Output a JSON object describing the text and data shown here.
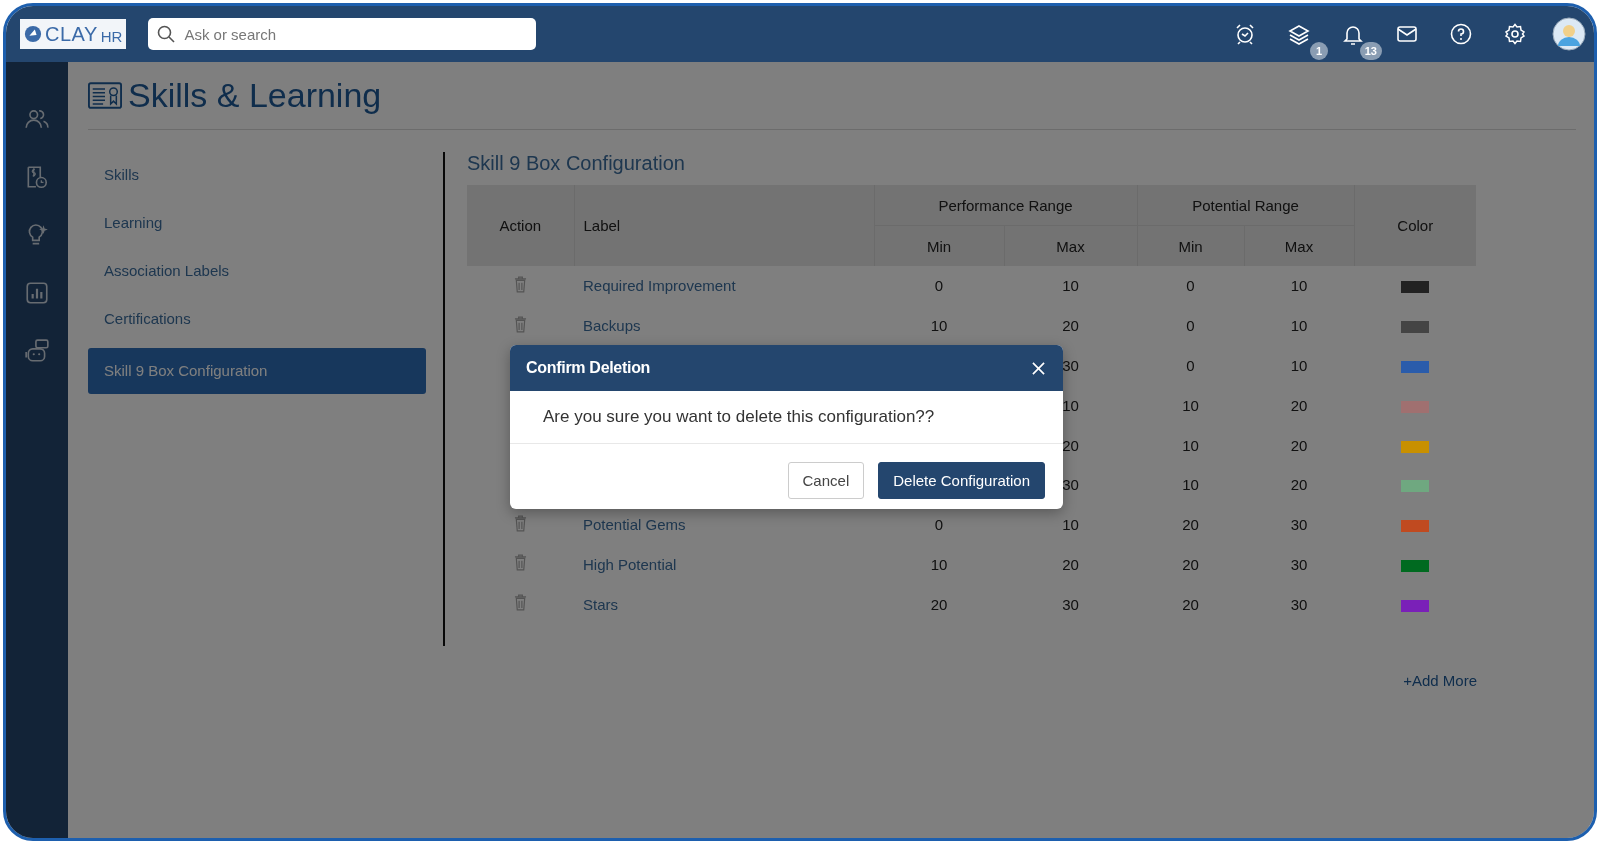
{
  "header": {
    "logo": {
      "brand": "CLAY",
      "suffix": "HR"
    },
    "search": {
      "placeholder": "Ask or search"
    },
    "layers_badge": "1",
    "bell_badge": "13"
  },
  "page": {
    "title": "Skills & Learning"
  },
  "nav": [
    {
      "label": "Skills",
      "selected": false
    },
    {
      "label": "Learning",
      "selected": false
    },
    {
      "label": "Association Labels",
      "selected": false
    },
    {
      "label": "Certifications",
      "selected": false
    },
    {
      "label": "Skill 9 Box Configuration",
      "selected": true
    }
  ],
  "section_title": "Skill 9 Box Configuration",
  "table": {
    "columns": {
      "action": "Action",
      "label": "Label",
      "performance": {
        "title": "Performance Range",
        "min": "Min",
        "max": "Max"
      },
      "potential": {
        "title": "Potential Range",
        "min": "Min",
        "max": "Max"
      },
      "color_header": "Color"
    },
    "rows": [
      {
        "label": "Required Improvement",
        "perf_min": "0",
        "perf_max": "10",
        "pot_min": "0",
        "pot_max": "10",
        "color": "#222222"
      },
      {
        "label": "Backups",
        "perf_min": "10",
        "perf_max": "20",
        "pot_min": "0",
        "pot_max": "10",
        "color": "#444444"
      },
      {
        "perf_max": "30",
        "pot_min": "0",
        "pot_max": "10",
        "color": "#2a5cab"
      },
      {
        "perf_max": "10",
        "pot_min": "10",
        "pot_max": "20",
        "color": "#a07070"
      },
      {
        "perf_max": "20",
        "pot_min": "10",
        "pot_max": "20",
        "color": "#c89000"
      },
      {
        "perf_max": "30",
        "pot_min": "10",
        "pot_max": "20",
        "color": "#6fa880"
      },
      {
        "label": "Potential Gems",
        "perf_min": "0",
        "perf_max": "10",
        "pot_min": "20",
        "pot_max": "30",
        "color": "#c04a20"
      },
      {
        "label": "High Potential",
        "perf_min": "10",
        "perf_max": "20",
        "pot_min": "20",
        "pot_max": "30",
        "color": "#006a20"
      },
      {
        "label": "Stars",
        "perf_min": "20",
        "perf_max": "30",
        "pot_min": "20",
        "pot_max": "30",
        "color": "#7a20b8"
      }
    ]
  },
  "add_more": "+Add More",
  "dialog": {
    "title": "Confirm Deletion",
    "message": "Are you sure you want to delete this configuration??",
    "cancel": "Cancel",
    "confirm": "Delete Configuration"
  }
}
